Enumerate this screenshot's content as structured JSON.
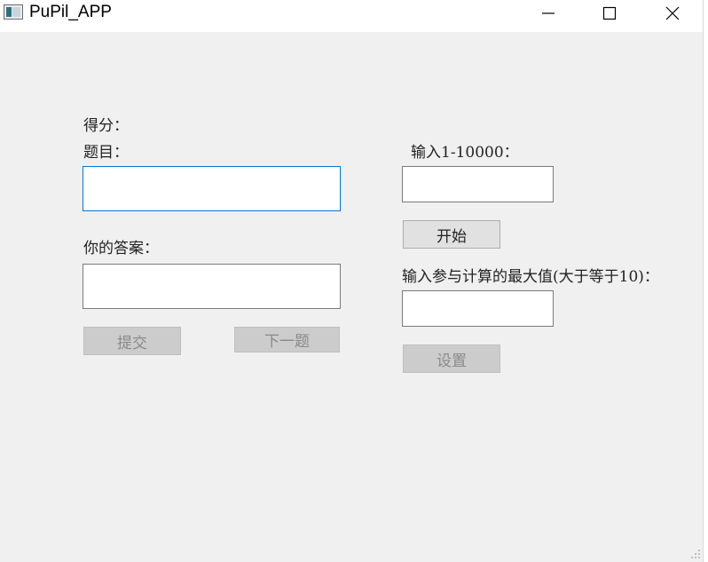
{
  "window": {
    "title": "PuPil_APP",
    "app_icon": "window-app-icon",
    "controls": {
      "minimize_icon": "minimize-icon",
      "maximize_icon": "maximize-icon",
      "close_icon": "close-icon"
    }
  },
  "quiz": {
    "score_label": "得分：",
    "question_label": "题目：",
    "question_value": "",
    "answer_label": "你的答案：",
    "answer_value": "",
    "submit_label": "提交",
    "next_label": "下一题"
  },
  "setup": {
    "count_label": "输入1-10000：",
    "count_value": "",
    "start_label": "开始",
    "max_label": "输入参与计算的最大值(大于等于10)：",
    "max_value": "",
    "set_label": "设置"
  },
  "colors": {
    "window_bg": "#f0f0f0",
    "titlebar_bg": "#ffffff",
    "focus_border": "#0078d7",
    "disabled_button_bg": "#cccccc",
    "button_bg": "#e1e1e1"
  }
}
